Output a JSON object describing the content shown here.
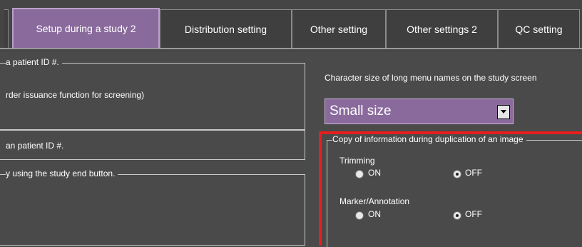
{
  "tabs": [
    {
      "label": "Setup during a study 2",
      "active": true
    },
    {
      "label": "Distribution setting",
      "active": false
    },
    {
      "label": "Other setting",
      "active": false
    },
    {
      "label": "Other settings 2",
      "active": false
    },
    {
      "label": "QC setting",
      "active": false
    }
  ],
  "left": {
    "group1_label": "a patient ID #.",
    "group1_text": "rder issuance function for screening)",
    "group2_label": "an patient ID #.",
    "group3_label": "y using the study end button."
  },
  "right": {
    "char_size_label": "Character size of long menu names on the study screen",
    "char_size_value": "Small size",
    "copy_group_label": "Copy of information during duplication of an image",
    "trimming": {
      "label": "Trimming",
      "on_label": "ON",
      "off_label": "OFF",
      "selected": "OFF"
    },
    "marker": {
      "label": "Marker/Annotation",
      "on_label": "ON",
      "off_label": "OFF",
      "selected": "OFF"
    }
  },
  "colors": {
    "accent": "#8a6a9c",
    "highlight_border": "#e51f1f",
    "background": "#4a4a4a"
  },
  "icons": {
    "dropdown": "chevron-down-icon"
  }
}
